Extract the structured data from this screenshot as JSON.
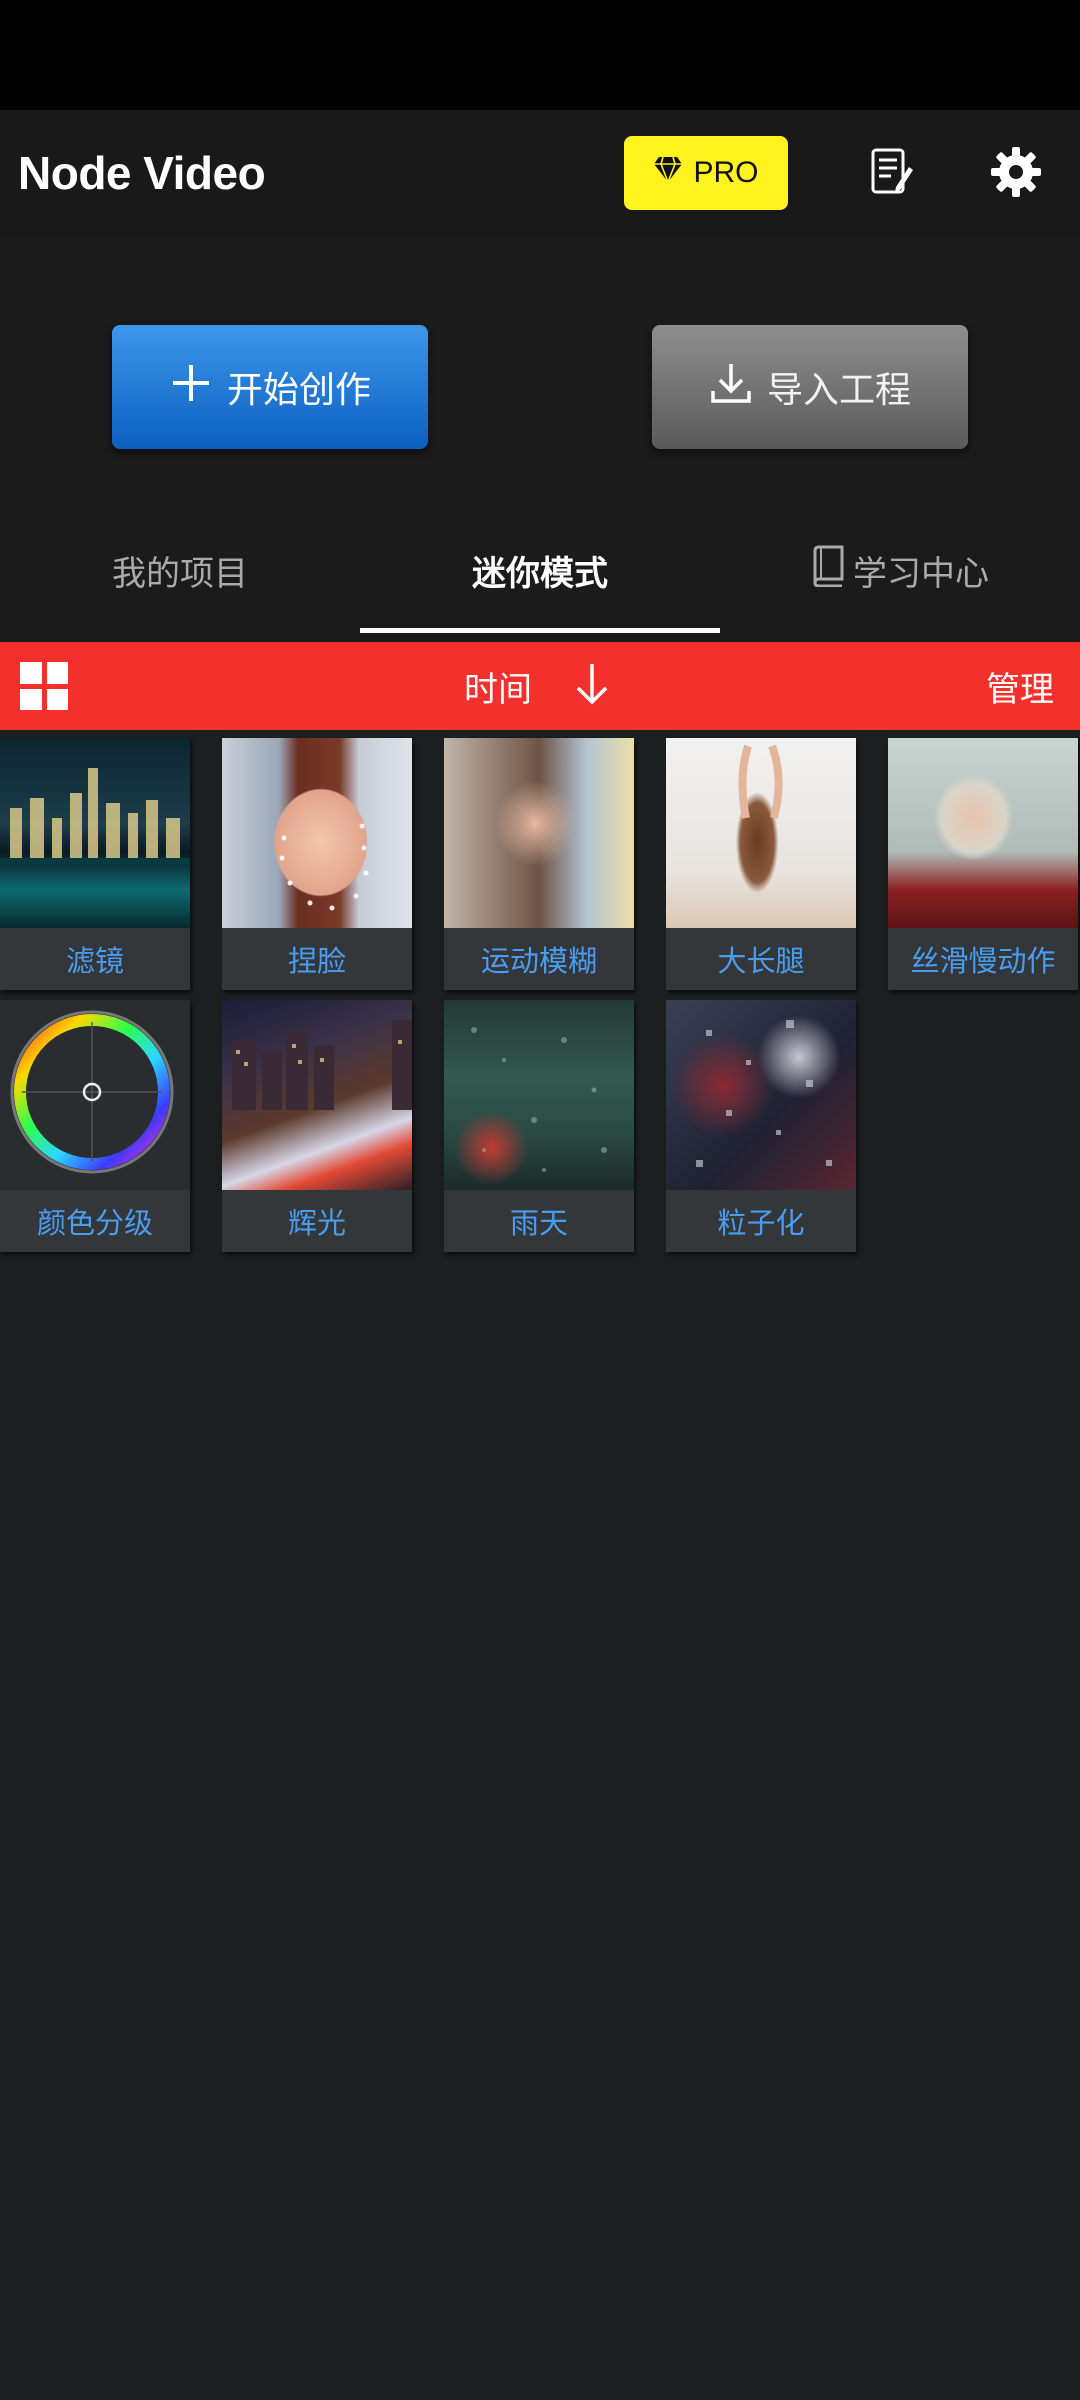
{
  "app": {
    "title": "Node Video",
    "pro_label": "PRO",
    "pro_color": "#fef21f"
  },
  "icons": {
    "pro": "diamond-icon",
    "notes": "notes-edit-icon",
    "settings": "gear-icon",
    "start": "plus-icon",
    "import": "download-icon",
    "learn": "book-icon",
    "layout": "grid-icon",
    "sort": "arrow-down-icon"
  },
  "actions": {
    "start_label": "开始创作",
    "import_label": "导入工程"
  },
  "tabs": [
    {
      "label": "我的项目"
    },
    {
      "label": "迷你模式"
    },
    {
      "label": "学习中心"
    }
  ],
  "active_tab": "迷你模式",
  "sortbar": {
    "sort_label": "时间",
    "manage_label": "管理",
    "bar_color": "#f3302b"
  },
  "presets": [
    {
      "label": "滤镜"
    },
    {
      "label": "捏脸"
    },
    {
      "label": "运动模糊"
    },
    {
      "label": "大长腿"
    },
    {
      "label": "丝滑慢动作"
    },
    {
      "label": "颜色分级"
    },
    {
      "label": "辉光"
    },
    {
      "label": "雨天"
    },
    {
      "label": "粒子化"
    }
  ]
}
